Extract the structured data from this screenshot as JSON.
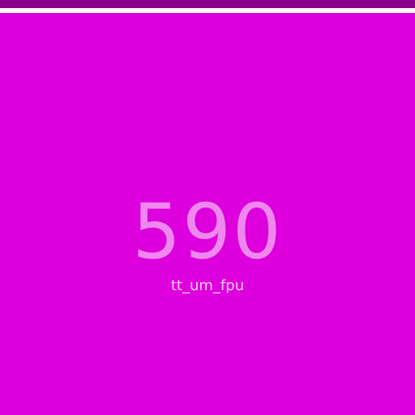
{
  "colors": {
    "background": "#dd00dd",
    "top_bar": "#880088",
    "number": "#ee88ee",
    "label": "#ffccff"
  },
  "display": {
    "value": "590",
    "label": "tt_um_fpu"
  }
}
